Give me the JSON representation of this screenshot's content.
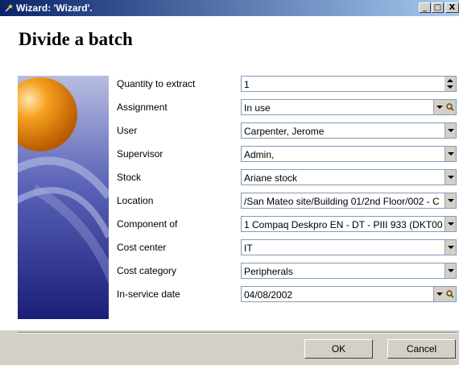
{
  "window": {
    "title": "Wizard: 'Wizard'.",
    "minimize": "_",
    "maximize": "□",
    "close": "X"
  },
  "page": {
    "title": "Divide a batch"
  },
  "form": {
    "rows": [
      {
        "label": "Quantity to extract",
        "value": "1",
        "control": "spinner"
      },
      {
        "label": "Assignment",
        "value": "In use",
        "control": "dropdown-zoom"
      },
      {
        "label": "User",
        "value": "Carpenter, Jerome",
        "control": "dropdown"
      },
      {
        "label": "Supervisor",
        "value": "Admin,",
        "control": "dropdown"
      },
      {
        "label": "Stock",
        "value": "Ariane stock",
        "control": "dropdown"
      },
      {
        "label": "Location",
        "value": "/San Mateo site/Building 01/2nd Floor/002 - C",
        "control": "dropdown"
      },
      {
        "label": "Component of",
        "value": "1 Compaq Deskpro EN - DT - PIII 933 (DKT00",
        "control": "dropdown"
      },
      {
        "label": "Cost center",
        "value": "IT",
        "control": "dropdown"
      },
      {
        "label": "Cost category",
        "value": "Peripherals",
        "control": "dropdown"
      },
      {
        "label": "In-service date",
        "value": "04/08/2002",
        "control": "dropdown-zoom"
      }
    ]
  },
  "buttons": {
    "ok": "OK",
    "cancel": "Cancel"
  },
  "icons": {
    "app": "wizard-app-icon",
    "zoom": "magnifier-icon"
  },
  "colors": {
    "title_bar_start": "#0a246a",
    "title_bar_end": "#a6caf0",
    "art_blue": "#2a2f8a",
    "sphere": "#f08a10"
  }
}
